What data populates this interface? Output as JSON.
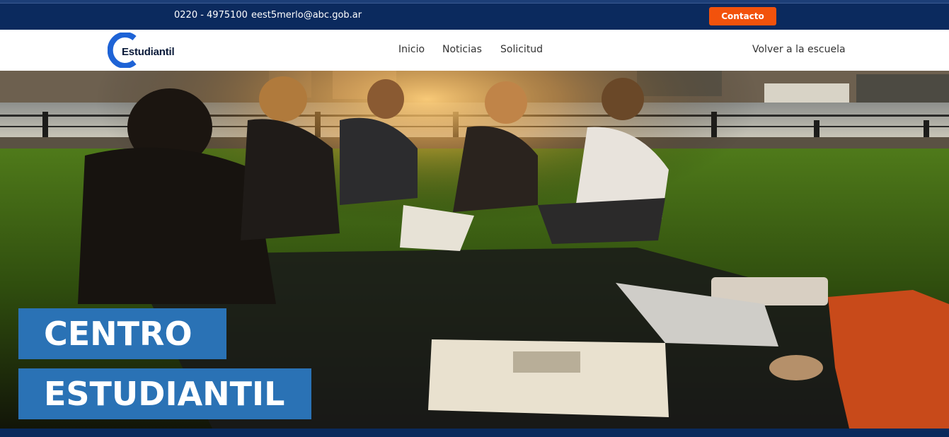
{
  "topbar": {
    "phone": "0220 - 4975100",
    "email": "eest5merlo@abc.gob.ar",
    "contact_label": "Contacto",
    "contact_color": "#f2520c",
    "background": "#0b2a5e"
  },
  "logo": {
    "text": "Estudiantil",
    "mark_color": "#1e63d6"
  },
  "nav": {
    "items": [
      {
        "label": "Inicio"
      },
      {
        "label": "Noticias"
      },
      {
        "label": "Solicitud"
      }
    ],
    "back_label": "Volver a la escuela"
  },
  "hero": {
    "title_line1": "CENTRO",
    "title_line2": "ESTUDIANTIL",
    "title_bg": "#2a72b5"
  }
}
